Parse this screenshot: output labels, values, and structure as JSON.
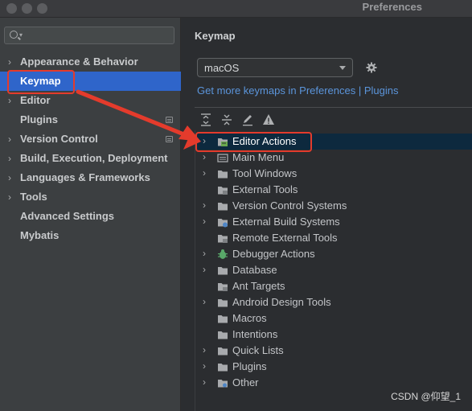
{
  "window": {
    "title": "Preferences"
  },
  "sidebar": {
    "search": {
      "value": "",
      "placeholder": ""
    },
    "items": [
      {
        "label": "Appearance & Behavior",
        "expandable": true,
        "selected": false,
        "badge": false
      },
      {
        "label": "Keymap",
        "expandable": false,
        "selected": true,
        "badge": false
      },
      {
        "label": "Editor",
        "expandable": true,
        "selected": false,
        "badge": false
      },
      {
        "label": "Plugins",
        "expandable": false,
        "selected": false,
        "badge": true
      },
      {
        "label": "Version Control",
        "expandable": true,
        "selected": false,
        "badge": true
      },
      {
        "label": "Build, Execution, Deployment",
        "expandable": true,
        "selected": false,
        "badge": false
      },
      {
        "label": "Languages & Frameworks",
        "expandable": true,
        "selected": false,
        "badge": false
      },
      {
        "label": "Tools",
        "expandable": true,
        "selected": false,
        "badge": false
      },
      {
        "label": "Advanced Settings",
        "expandable": false,
        "selected": false,
        "badge": false
      },
      {
        "label": "Mybatis",
        "expandable": false,
        "selected": false,
        "badge": false
      }
    ]
  },
  "main": {
    "title": "Keymap",
    "keymap_select": {
      "value": "macOS"
    },
    "link": "Get more keymaps in Preferences | Plugins",
    "toolbar": [
      "expand-all-icon",
      "collapse-all-icon",
      "edit-icon",
      "warning-icon"
    ],
    "tree": [
      {
        "label": "Editor Actions",
        "expandable": true,
        "icon": "editor-actions-icon",
        "selected": true
      },
      {
        "label": "Main Menu",
        "expandable": true,
        "icon": "main-menu-icon",
        "selected": false
      },
      {
        "label": "Tool Windows",
        "expandable": true,
        "icon": "folder-icon",
        "selected": false
      },
      {
        "label": "External Tools",
        "expandable": false,
        "icon": "folder-tools-icon",
        "selected": false
      },
      {
        "label": "Version Control Systems",
        "expandable": true,
        "icon": "folder-icon",
        "selected": false
      },
      {
        "label": "External Build Systems",
        "expandable": true,
        "icon": "build-systems-icon",
        "selected": false
      },
      {
        "label": "Remote External Tools",
        "expandable": false,
        "icon": "folder-tools-icon",
        "selected": false
      },
      {
        "label": "Debugger Actions",
        "expandable": true,
        "icon": "debugger-bug-icon",
        "selected": false
      },
      {
        "label": "Database",
        "expandable": true,
        "icon": "folder-icon",
        "selected": false
      },
      {
        "label": "Ant Targets",
        "expandable": false,
        "icon": "folder-tools-icon",
        "selected": false
      },
      {
        "label": "Android Design Tools",
        "expandable": true,
        "icon": "folder-icon",
        "selected": false
      },
      {
        "label": "Macros",
        "expandable": false,
        "icon": "folder-icon",
        "selected": false
      },
      {
        "label": "Intentions",
        "expandable": false,
        "icon": "folder-icon",
        "selected": false
      },
      {
        "label": "Quick Lists",
        "expandable": true,
        "icon": "folder-icon",
        "selected": false
      },
      {
        "label": "Plugins",
        "expandable": true,
        "icon": "folder-icon",
        "selected": false
      },
      {
        "label": "Other",
        "expandable": true,
        "icon": "other-icon",
        "selected": false
      }
    ]
  },
  "watermark": "CSDN @仰望_1",
  "colors": {
    "selection": "#2f65ca",
    "link": "#5b95db",
    "annotation": "#e43b2c",
    "tree_selection": "#0d293e"
  }
}
